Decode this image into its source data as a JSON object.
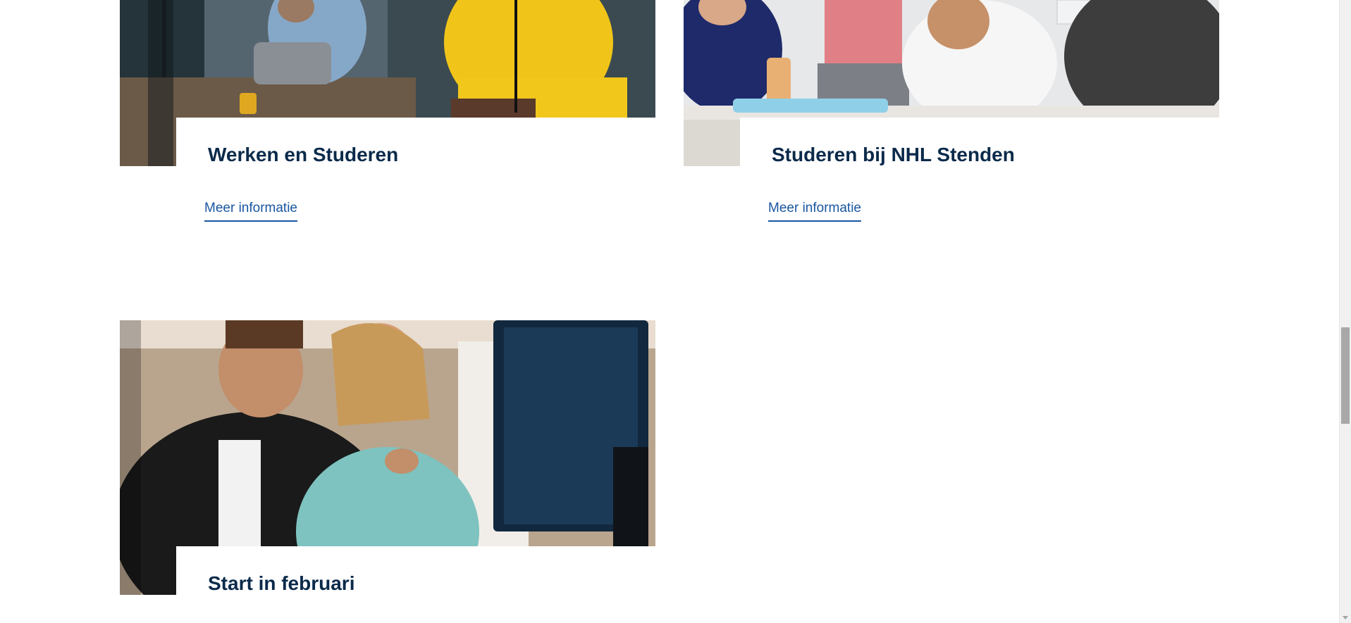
{
  "cards": [
    {
      "title": "Werken en Studeren",
      "link_label": "Meer informatie",
      "image_alt": "Studenten werken op laptops in een kantoor"
    },
    {
      "title": "Studeren bij NHL Stenden",
      "link_label": "Meer informatie",
      "image_alt": "Studenten studeren aan een tafel"
    },
    {
      "title": "Start in februari",
      "image_alt": "Twee studenten kijken naar een computerscherm"
    }
  ],
  "colors": {
    "title": "#0b2a4a",
    "link": "#1a56a0",
    "background": "#ffffff"
  }
}
